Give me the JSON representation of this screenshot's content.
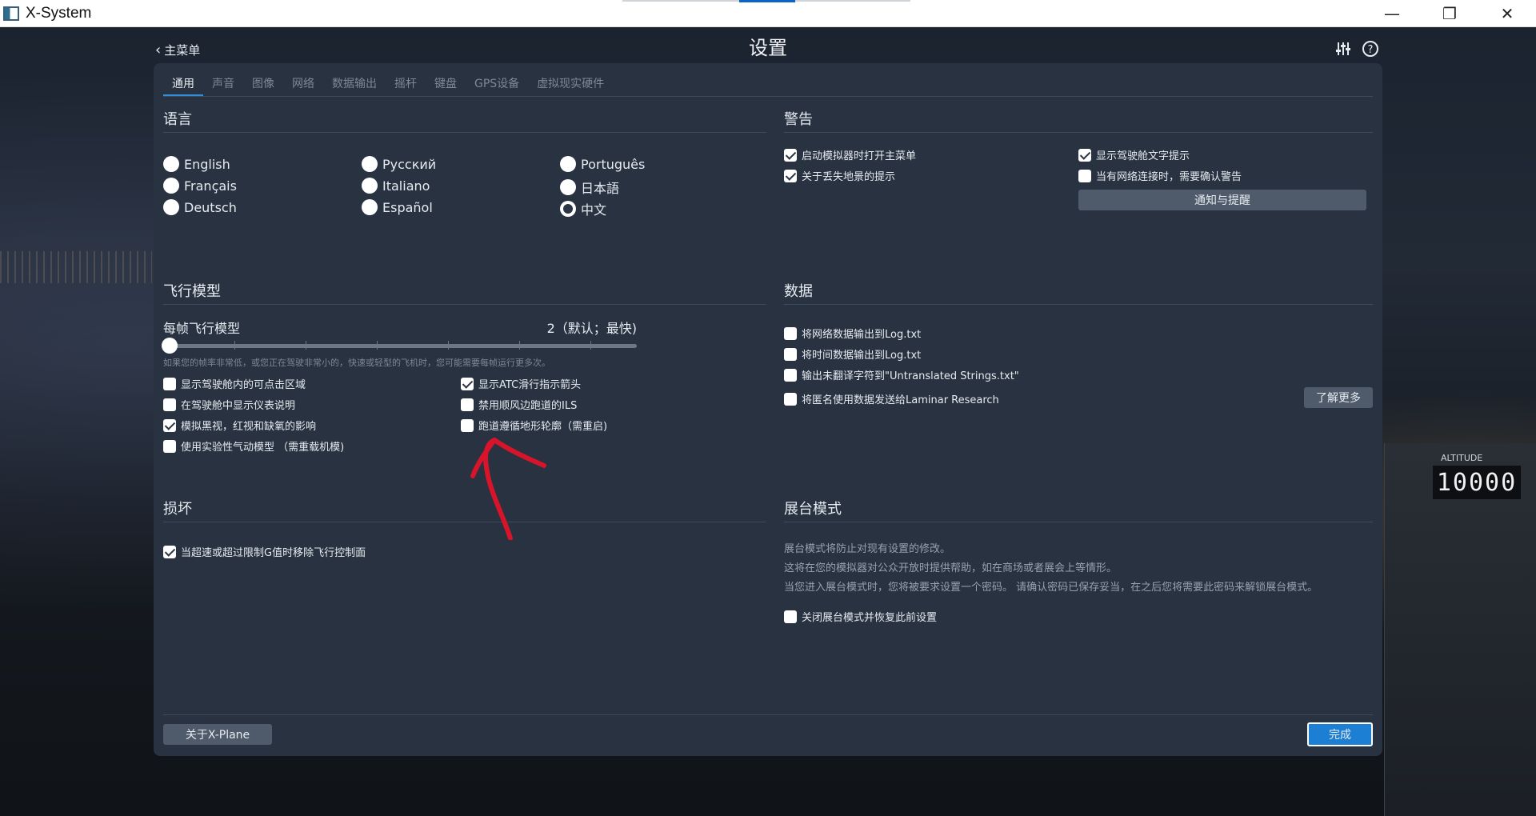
{
  "window": {
    "title": "X-System",
    "minimize": "—",
    "restore": "❐",
    "close": "✕"
  },
  "header": {
    "back_label": "主菜单",
    "title": "设置"
  },
  "tabs": [
    {
      "label": "通用"
    },
    {
      "label": "声音"
    },
    {
      "label": "图像"
    },
    {
      "label": "网络"
    },
    {
      "label": "数据输出"
    },
    {
      "label": "摇杆"
    },
    {
      "label": "键盘"
    },
    {
      "label": "GPS设备"
    },
    {
      "label": "虚拟现实硬件"
    }
  ],
  "language": {
    "title": "语言",
    "options": [
      {
        "label": "English"
      },
      {
        "label": "Français"
      },
      {
        "label": "Deutsch"
      },
      {
        "label": "Русский"
      },
      {
        "label": "Italiano"
      },
      {
        "label": "Español"
      },
      {
        "label": "Português"
      },
      {
        "label": "日本語"
      },
      {
        "label": "中文"
      }
    ],
    "selected": "中文"
  },
  "warnings": {
    "title": "警告",
    "items": [
      {
        "label": "启动模拟器时打开主菜单",
        "checked": true
      },
      {
        "label": "关于丢失地景的提示",
        "checked": true
      },
      {
        "label": "显示驾驶舱文字提示",
        "checked": true
      },
      {
        "label": "当有网络连接时，需要确认警告",
        "checked": false
      }
    ],
    "button": "通知与提醒"
  },
  "flight_model": {
    "title": "飞行模型",
    "slider_label": "每帧飞行模型",
    "slider_value": "2（默认；最快)",
    "slider_level": 0,
    "hint": "如果您的帧率非常低，或您正在驾驶非常小的，快速或轻型的飞机时，您可能需要每帧运行更多次。",
    "items": [
      {
        "label": "显示驾驶舱内的可点击区域",
        "checked": false
      },
      {
        "label": "在驾驶舱中显示仪表说明",
        "checked": false
      },
      {
        "label": "模拟黑视，红视和缺氧的影响",
        "checked": true
      },
      {
        "label": "使用实验性气动模型 （需重载机模)",
        "checked": false
      },
      {
        "label": "显示ATC滑行指示箭头",
        "checked": true
      },
      {
        "label": "禁用顺风边跑道的ILS",
        "checked": false
      },
      {
        "label": "跑道遵循地形轮廓（需重启)",
        "checked": false
      }
    ]
  },
  "data": {
    "title": "数据",
    "items": [
      {
        "label": "将网络数据输出到Log.txt",
        "checked": false
      },
      {
        "label": "将时间数据输出到Log.txt",
        "checked": false
      },
      {
        "label": "输出未翻译字符到\"Untranslated Strings.txt\"",
        "checked": false
      },
      {
        "label": "将匿名使用数据发送给Laminar Research",
        "checked": false
      }
    ],
    "learn_more": "了解更多"
  },
  "damage": {
    "title": "损坏",
    "items": [
      {
        "label": "当超速或超过限制G值时移除飞行控制面",
        "checked": true
      }
    ]
  },
  "kiosk": {
    "title": "展台模式",
    "lines": [
      "展台模式将防止对现有设置的修改。",
      "这将在您的模拟器对公众开放时提供帮助，如在商场或者展会上等情形。",
      "当您进入展台模式时，您将被要求设置一个密码。 请确认密码已保存妥当，在之后您将需要此密码来解锁展台模式。"
    ],
    "items": [
      {
        "label": "关闭展台模式并恢复此前设置",
        "checked": false
      }
    ]
  },
  "footer": {
    "about": "关于X-Plane",
    "done": "完成"
  },
  "background": {
    "altitude_label": "ALTITUDE",
    "altitude_value": "10000"
  },
  "colors": {
    "panel": "#283240",
    "accent": "#1c7fd4",
    "annotation": "#d8142a"
  }
}
